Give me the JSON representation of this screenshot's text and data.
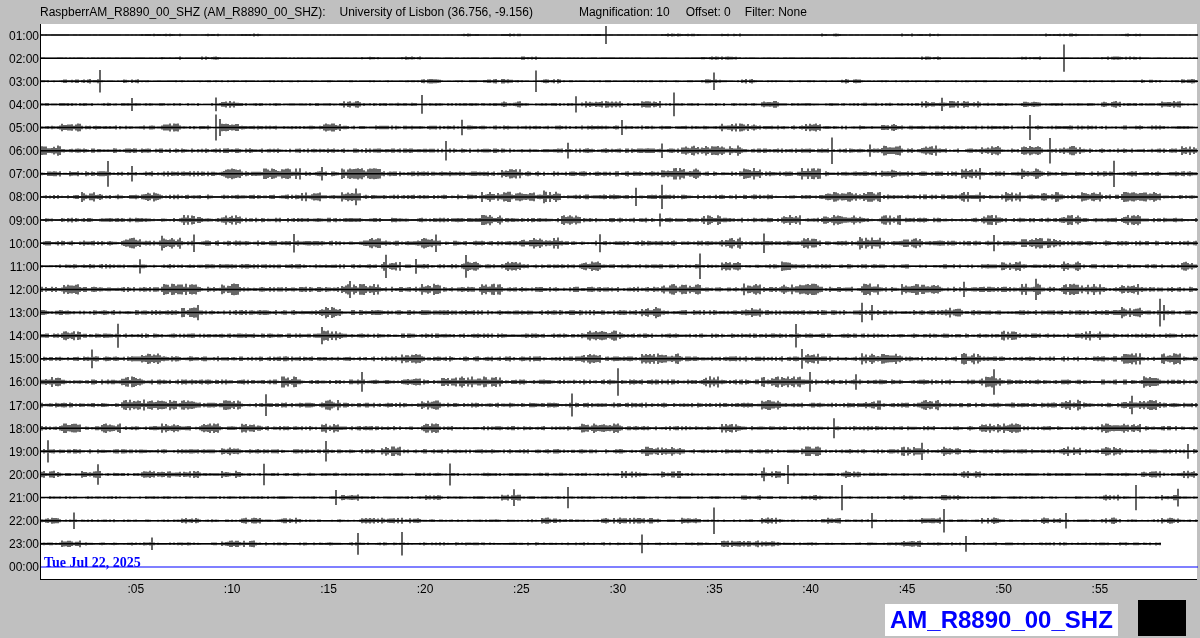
{
  "header": {
    "station": "RaspberrAM_R8890_00_SHZ (AM_R8890_00_SHZ):",
    "location": "University of Lisbon (36.756, -9.156)",
    "magnification": "Magnification: 10",
    "offset": "Offset: 0",
    "filter": "Filter: None"
  },
  "rows": [
    {
      "label": "01:00",
      "kind": "trace"
    },
    {
      "label": "02:00",
      "kind": "trace"
    },
    {
      "label": "03:00",
      "kind": "trace"
    },
    {
      "label": "04:00",
      "kind": "trace"
    },
    {
      "label": "05:00",
      "kind": "trace"
    },
    {
      "label": "06:00",
      "kind": "trace"
    },
    {
      "label": "07:00",
      "kind": "trace"
    },
    {
      "label": "08:00",
      "kind": "trace"
    },
    {
      "label": "09:00",
      "kind": "trace"
    },
    {
      "label": "10:00",
      "kind": "trace"
    },
    {
      "label": "11:00",
      "kind": "trace"
    },
    {
      "label": "12:00",
      "kind": "trace"
    },
    {
      "label": "13:00",
      "kind": "trace"
    },
    {
      "label": "14:00",
      "kind": "trace"
    },
    {
      "label": "15:00",
      "kind": "trace"
    },
    {
      "label": "16:00",
      "kind": "trace"
    },
    {
      "label": "17:00",
      "kind": "trace"
    },
    {
      "label": "18:00",
      "kind": "trace"
    },
    {
      "label": "19:00",
      "kind": "trace"
    },
    {
      "label": "20:00",
      "kind": "trace"
    },
    {
      "label": "21:00",
      "kind": "trace"
    },
    {
      "label": "22:00",
      "kind": "trace"
    },
    {
      "label": "23:00",
      "kind": "partial"
    },
    {
      "label": "00:00",
      "kind": "current"
    }
  ],
  "date": "Tue Jul 22, 2025",
  "ticks": [
    ":05",
    ":10",
    ":15",
    ":20",
    ":25",
    ":30",
    ":35",
    ":40",
    ":45",
    ":50",
    ":55"
  ],
  "channel": "AM_R8890_00_SHZ"
}
